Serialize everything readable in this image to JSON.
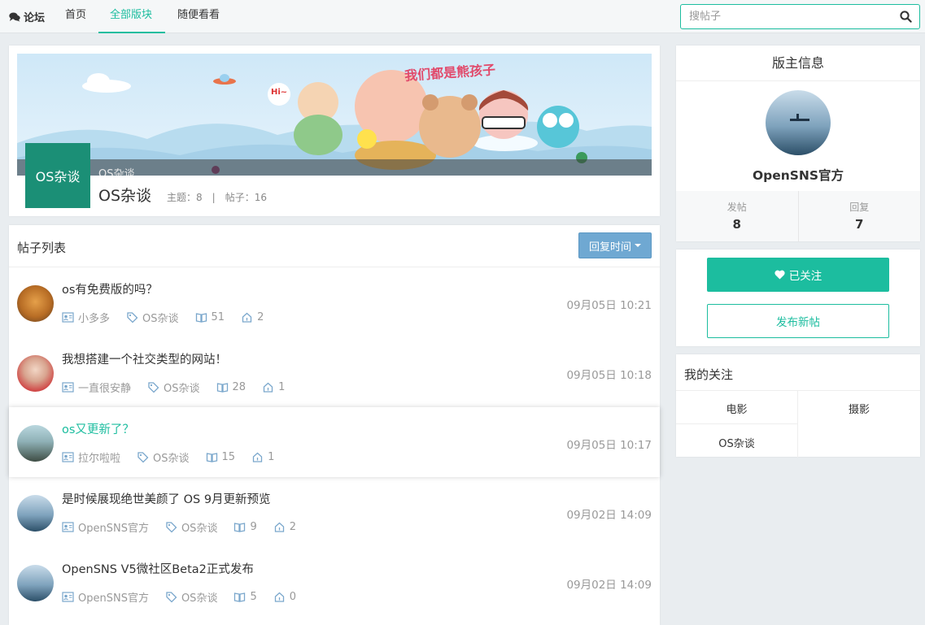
{
  "nav": {
    "brand": "论坛",
    "items": [
      "首页",
      "全部版块",
      "随便看看"
    ],
    "active_index": 1,
    "search_placeholder": "搜帖子"
  },
  "board": {
    "name": "OS杂谈",
    "logo_text": "OS杂谈",
    "banner_caption": "OS杂谈",
    "topics": "主题：8",
    "posts": "帖子：16",
    "separator": "|",
    "banner_art_text": "我们都是熊孩子"
  },
  "list": {
    "title": "帖子列表",
    "sort_label": "回复时间",
    "posts": [
      {
        "title": "os有免费版的吗？",
        "author": "小多多",
        "board": "OS杂谈",
        "views": "51",
        "replies": "2",
        "time": "09月05日 10:21",
        "highlighted": false
      },
      {
        "title": "我想搭建一个社交类型的网站！",
        "author": "一直很安静",
        "board": "OS杂谈",
        "views": "28",
        "replies": "1",
        "time": "09月05日 10:18",
        "highlighted": false
      },
      {
        "title": "os又更新了？",
        "author": "拉尔啦啦",
        "board": "OS杂谈",
        "views": "15",
        "replies": "1",
        "time": "09月05日 10:17",
        "highlighted": true
      },
      {
        "title": "是时候展现绝世美颜了 OS 9月更新预览",
        "author": "OpenSNS官方",
        "board": "OS杂谈",
        "views": "9",
        "replies": "2",
        "time": "09月02日 14:09",
        "highlighted": false
      },
      {
        "title": "OpenSNS V5微社区Beta2正式发布",
        "author": "OpenSNS官方",
        "board": "OS杂谈",
        "views": "5",
        "replies": "0",
        "time": "09月02日 14:09",
        "highlighted": false
      }
    ]
  },
  "moderator": {
    "heading": "版主信息",
    "name": "OpenSNS官方",
    "posts_label": "发帖",
    "posts_value": "8",
    "replies_label": "回复",
    "replies_value": "7"
  },
  "actions": {
    "follow_label": "已关注",
    "new_post_label": "发布新帖"
  },
  "favorites": {
    "heading": "我的关注",
    "items": [
      "电影",
      "摄影",
      "OS杂谈"
    ]
  },
  "colors": {
    "accent": "#1cbd9f",
    "logo_bg": "#1b8f76",
    "sort_button": "#6fa8d2"
  }
}
